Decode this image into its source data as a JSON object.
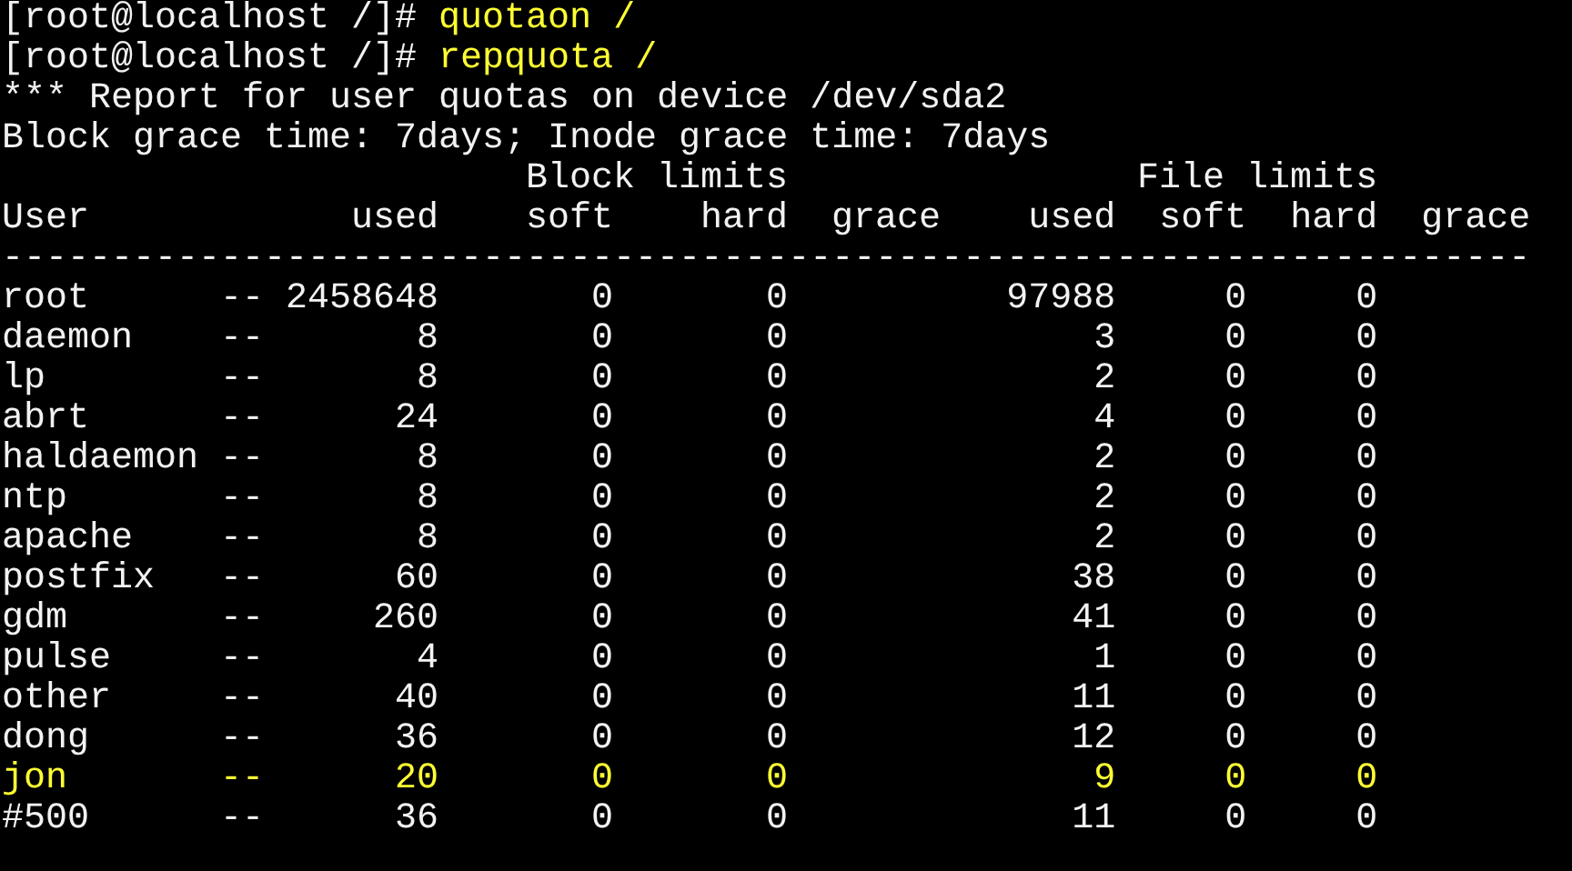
{
  "commands": [
    {
      "prompt": "[root@localhost /]#",
      "command": "quotaon /"
    },
    {
      "prompt": "[root@localhost /]#",
      "command": "repquota /"
    }
  ],
  "report_lines": [
    "*** Report for user quotas on device /dev/sda2",
    "Block grace time: 7days; Inode grace time: 7days"
  ],
  "group_headers": {
    "block": "Block limits",
    "file": "File limits"
  },
  "columns": [
    "User",
    "used",
    "soft",
    "hard",
    "grace",
    "used",
    "soft",
    "hard",
    "grace"
  ],
  "separator": "----------------------------------------------------------------------",
  "rows": [
    {
      "user": "root",
      "flag": "--",
      "block_used": "2458648",
      "block_soft": "0",
      "block_hard": "0",
      "file_used": "97988",
      "file_soft": "0",
      "file_hard": "0",
      "highlighted": false
    },
    {
      "user": "daemon",
      "flag": "--",
      "block_used": "8",
      "block_soft": "0",
      "block_hard": "0",
      "file_used": "3",
      "file_soft": "0",
      "file_hard": "0",
      "highlighted": false
    },
    {
      "user": "lp",
      "flag": "--",
      "block_used": "8",
      "block_soft": "0",
      "block_hard": "0",
      "file_used": "2",
      "file_soft": "0",
      "file_hard": "0",
      "highlighted": false
    },
    {
      "user": "abrt",
      "flag": "--",
      "block_used": "24",
      "block_soft": "0",
      "block_hard": "0",
      "file_used": "4",
      "file_soft": "0",
      "file_hard": "0",
      "highlighted": false
    },
    {
      "user": "haldaemon",
      "flag": "--",
      "block_used": "8",
      "block_soft": "0",
      "block_hard": "0",
      "file_used": "2",
      "file_soft": "0",
      "file_hard": "0",
      "highlighted": false
    },
    {
      "user": "ntp",
      "flag": "--",
      "block_used": "8",
      "block_soft": "0",
      "block_hard": "0",
      "file_used": "2",
      "file_soft": "0",
      "file_hard": "0",
      "highlighted": false
    },
    {
      "user": "apache",
      "flag": "--",
      "block_used": "8",
      "block_soft": "0",
      "block_hard": "0",
      "file_used": "2",
      "file_soft": "0",
      "file_hard": "0",
      "highlighted": false
    },
    {
      "user": "postfix",
      "flag": "--",
      "block_used": "60",
      "block_soft": "0",
      "block_hard": "0",
      "file_used": "38",
      "file_soft": "0",
      "file_hard": "0",
      "highlighted": false
    },
    {
      "user": "gdm",
      "flag": "--",
      "block_used": "260",
      "block_soft": "0",
      "block_hard": "0",
      "file_used": "41",
      "file_soft": "0",
      "file_hard": "0",
      "highlighted": false
    },
    {
      "user": "pulse",
      "flag": "--",
      "block_used": "4",
      "block_soft": "0",
      "block_hard": "0",
      "file_used": "1",
      "file_soft": "0",
      "file_hard": "0",
      "highlighted": false
    },
    {
      "user": "other",
      "flag": "--",
      "block_used": "40",
      "block_soft": "0",
      "block_hard": "0",
      "file_used": "11",
      "file_soft": "0",
      "file_hard": "0",
      "highlighted": false
    },
    {
      "user": "dong",
      "flag": "--",
      "block_used": "36",
      "block_soft": "0",
      "block_hard": "0",
      "file_used": "12",
      "file_soft": "0",
      "file_hard": "0",
      "highlighted": false
    },
    {
      "user": "jon",
      "flag": "--",
      "block_used": "20",
      "block_soft": "0",
      "block_hard": "0",
      "file_used": "9",
      "file_soft": "0",
      "file_hard": "0",
      "highlighted": true
    },
    {
      "user": "#500",
      "flag": "--",
      "block_used": "36",
      "block_soft": "0",
      "block_hard": "0",
      "file_used": "11",
      "file_soft": "0",
      "file_hard": "0",
      "highlighted": false
    }
  ]
}
